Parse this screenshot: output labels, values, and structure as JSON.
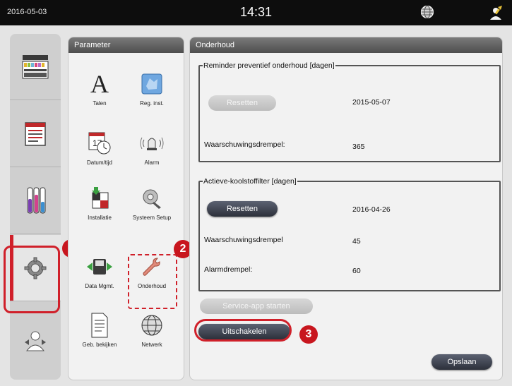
{
  "status_bar": {
    "date": "2016-05-03",
    "time": "14:31"
  },
  "param_panel": {
    "title": "Parameter",
    "items": [
      {
        "label": "Talen",
        "icon": "language-icon"
      },
      {
        "label": "Reg. inst.",
        "icon": "region-settings-icon"
      },
      {
        "label": "Datum/tijd",
        "icon": "calendar-clock-icon"
      },
      {
        "label": "Alarm",
        "icon": "alarm-icon"
      },
      {
        "label": "Installatie",
        "icon": "installation-icon"
      },
      {
        "label": "Systeem Setup",
        "icon": "system-setup-icon"
      },
      {
        "label": "Data Mgmt.",
        "icon": "data-management-icon"
      },
      {
        "label": "Onderhoud",
        "icon": "maintenance-wrench-icon"
      },
      {
        "label": "Geb. bekijken",
        "icon": "event-log-icon"
      },
      {
        "label": "Netwerk",
        "icon": "network-globe-icon"
      }
    ]
  },
  "main_panel": {
    "title": "Onderhoud",
    "group1": {
      "legend": "Reminder preventief onderhoud [dagen]",
      "reset_label": "Resetten",
      "reset_date": "2015-05-07",
      "threshold_label": "Waarschuwingsdrempel:",
      "threshold_value": "365"
    },
    "group2": {
      "legend": "Actieve-koolstoffilter [dagen]",
      "reset_label": "Resetten",
      "reset_date": "2016-04-26",
      "threshold_label": "Waarschuwingsdrempel",
      "threshold_value": "45",
      "alarm_label": "Alarmdrempel:",
      "alarm_value": "60"
    },
    "service_app_label": "Service-app starten",
    "shutdown_label": "Uitschakelen",
    "save_label": "Opslaan"
  },
  "callouts": [
    "1",
    "2",
    "3"
  ],
  "colors": {
    "accent_red": "#d0202a",
    "header_dark": "#4e4e4e",
    "button_dark": "#2c303a"
  }
}
